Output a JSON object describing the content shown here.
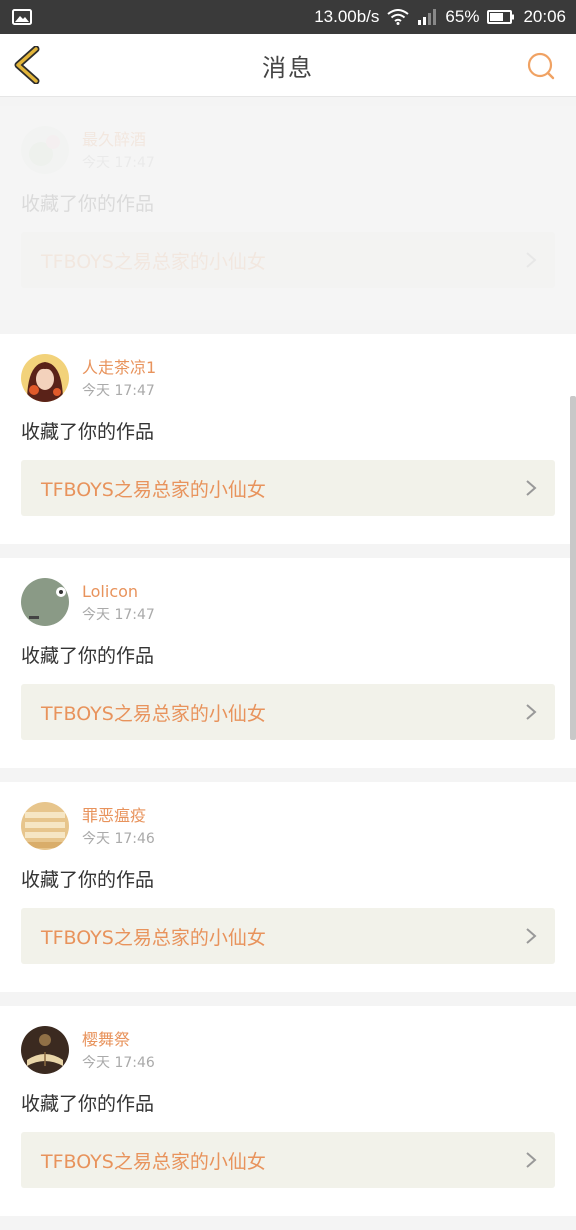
{
  "status_bar": {
    "speed": "13.00b/s",
    "battery": "65%",
    "time": "20:06",
    "icons": [
      "image-icon",
      "wifi-icon",
      "signal-icon",
      "battery-icon"
    ]
  },
  "header": {
    "title": "消息",
    "back_icon": "chevron-left-icon",
    "search_icon": "search-icon"
  },
  "colors": {
    "accent": "#e8935c",
    "back_icon": "#e2b53a",
    "link_bg": "#f2f2ea"
  },
  "messages": [
    {
      "user": "最久醉酒",
      "time": "今天 17:47",
      "action": "收藏了你的作品",
      "work": "TFBOYS之易总家的小仙女"
    },
    {
      "user": "人走茶凉1",
      "time": "今天 17:47",
      "action": "收藏了你的作品",
      "work": "TFBOYS之易总家的小仙女"
    },
    {
      "user": "Lolicon",
      "time": "今天 17:47",
      "action": "收藏了你的作品",
      "work": "TFBOYS之易总家的小仙女"
    },
    {
      "user": "罪恶瘟疫",
      "time": "今天 17:46",
      "action": "收藏了你的作品",
      "work": "TFBOYS之易总家的小仙女"
    },
    {
      "user": "樱舞祭",
      "time": "今天 17:46",
      "action": "收藏了你的作品",
      "work": "TFBOYS之易总家的小仙女"
    }
  ]
}
